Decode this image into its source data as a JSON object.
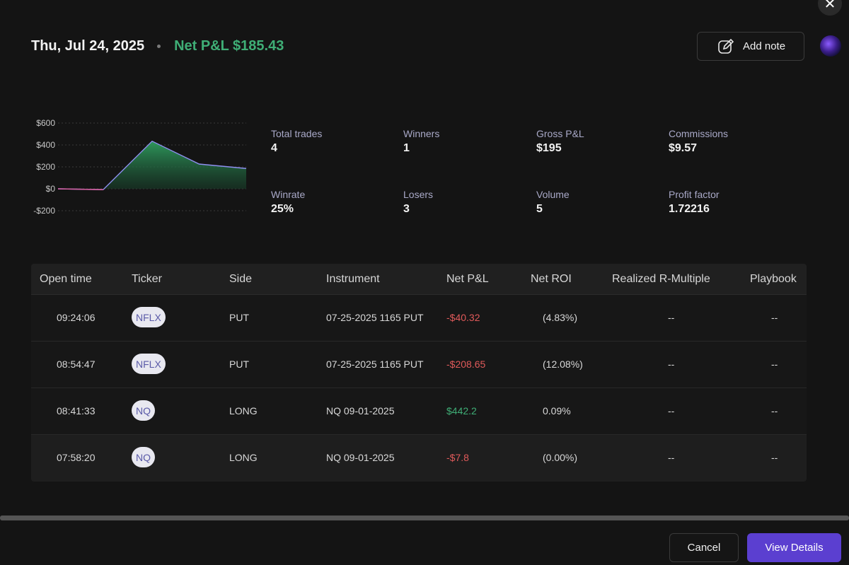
{
  "header": {
    "date": "Thu, Jul 24, 2025",
    "net_pnl": "Net P&L $185.43"
  },
  "actions": {
    "add_note": "Add note",
    "cancel": "Cancel",
    "view_details": "View Details"
  },
  "icons": {
    "close": "close-icon",
    "add_note": "edit-note-icon",
    "avatar": "avatar"
  },
  "colors": {
    "positive": "#3fae76",
    "negative": "#e05a5a",
    "accent": "#5b3fd0"
  },
  "stats": [
    {
      "label": "Total trades",
      "value": "4"
    },
    {
      "label": "Winners",
      "value": "1"
    },
    {
      "label": "Gross P&L",
      "value": "$195"
    },
    {
      "label": "Commissions",
      "value": "$9.57"
    },
    {
      "label": "Winrate",
      "value": "25%"
    },
    {
      "label": "Losers",
      "value": "3"
    },
    {
      "label": "Volume",
      "value": "5"
    },
    {
      "label": "Profit factor",
      "value": "1.72216"
    }
  ],
  "chart_data": {
    "type": "area",
    "x": [
      0,
      1,
      2,
      3,
      4,
      5
    ],
    "values": [
      0,
      -7.8,
      434.4,
      225.75,
      185.43,
      185.43
    ],
    "ytick_labels": [
      "$600",
      "$400",
      "$200",
      "$0",
      "-$200"
    ],
    "yticks": [
      600,
      400,
      200,
      0,
      -200
    ],
    "ylim": [
      -200,
      600
    ],
    "grid": true
  },
  "table": {
    "headers": [
      "Open time",
      "Ticker",
      "Side",
      "Instrument",
      "Net P&L",
      "Net ROI",
      "Realized R-Multiple",
      "Playbook"
    ],
    "rows": [
      {
        "time": "09:24:06",
        "ticker": "NFLX",
        "side": "PUT",
        "instrument": "07-25-2025 1165 PUT",
        "pnl": "-$40.32",
        "pnl_sign": "neg",
        "roi": "(4.83%)",
        "r_multiple": "--",
        "playbook": "--"
      },
      {
        "time": "08:54:47",
        "ticker": "NFLX",
        "side": "PUT",
        "instrument": "07-25-2025 1165 PUT",
        "pnl": "-$208.65",
        "pnl_sign": "neg",
        "roi": "(12.08%)",
        "r_multiple": "--",
        "playbook": "--"
      },
      {
        "time": "08:41:33",
        "ticker": "NQ",
        "side": "LONG",
        "instrument": "NQ 09-01-2025",
        "pnl": "$442.2",
        "pnl_sign": "pos",
        "roi": "0.09%",
        "r_multiple": "--",
        "playbook": "--"
      },
      {
        "time": "07:58:20",
        "ticker": "NQ",
        "side": "LONG",
        "instrument": "NQ 09-01-2025",
        "pnl": "-$7.8",
        "pnl_sign": "neg",
        "roi": "(0.00%)",
        "r_multiple": "--",
        "playbook": "--"
      }
    ]
  }
}
